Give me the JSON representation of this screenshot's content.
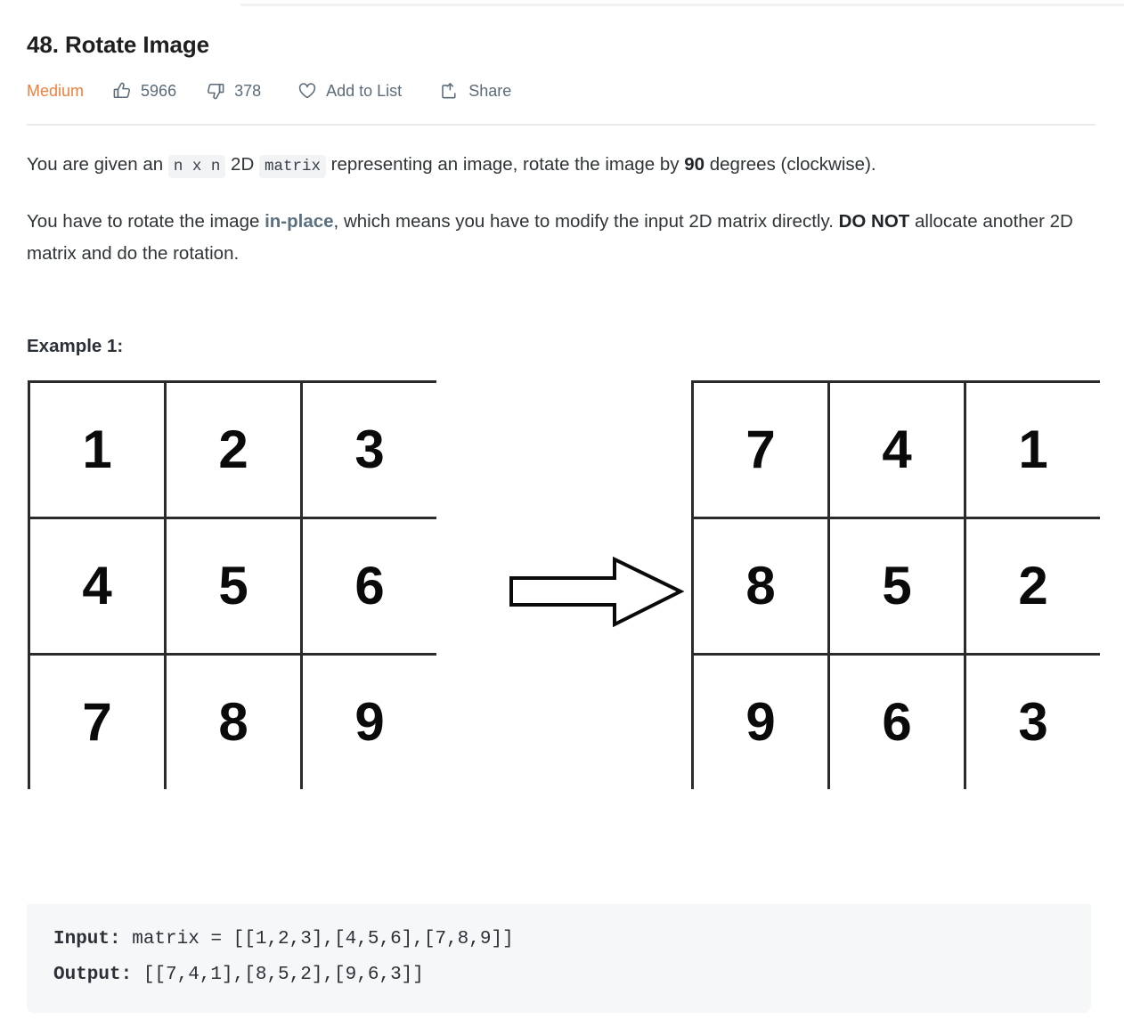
{
  "header": {
    "title": "48. Rotate Image",
    "difficulty": "Medium",
    "actions": [
      {
        "icon": "thumbs-up-icon",
        "label": "5966",
        "name": "likes-button"
      },
      {
        "icon": "thumbs-down-icon",
        "label": "378",
        "name": "dislikes-button"
      },
      {
        "icon": "heart-icon",
        "label": "Add to List",
        "name": "add-to-list-button"
      },
      {
        "icon": "share-icon",
        "label": "Share",
        "name": "share-button"
      }
    ]
  },
  "description": {
    "p1_part1": "You are given an ",
    "p1_code1": "n x n",
    "p1_part2": " 2D ",
    "p1_code2": "matrix",
    "p1_part3": " representing an image, rotate the image by ",
    "p1_bold": "90",
    "p1_part4": " degrees (clockwise).",
    "p2_part1": "You have to rotate the image ",
    "p2_link": "in-place",
    "p2_part2": ", which means you have to modify the input 2D matrix directly. ",
    "p2_bold": "DO NOT",
    "p2_part3": " allocate another 2D matrix and do the rotation."
  },
  "example": {
    "heading": "Example 1:",
    "input_label": "Input:",
    "input_value": " matrix = [[1,2,3],[4,5,6],[7,8,9]]",
    "output_label": "Output:",
    "output_value": " [[7,4,1],[8,5,2],[9,6,3]]",
    "arrow_icon": "right-arrow-icon"
  },
  "chart_data": {
    "type": "table",
    "title": "Example 1: 3x3 matrix rotated 90 degrees clockwise",
    "matrices": [
      {
        "name": "input-matrix",
        "rows": [
          [
            "1",
            "2",
            "3"
          ],
          [
            "4",
            "5",
            "6"
          ],
          [
            "7",
            "8",
            "9"
          ]
        ]
      },
      {
        "name": "output-matrix",
        "rows": [
          [
            "7",
            "4",
            "1"
          ],
          [
            "8",
            "5",
            "2"
          ],
          [
            "9",
            "6",
            "3"
          ]
        ]
      }
    ]
  },
  "colors": {
    "difficulty_medium": "#ef7f3c",
    "action_gray": "#5b6b79",
    "link_inplace": "#5c7080",
    "code_block_bg": "#f6f7f9",
    "grid_line": "#2b2b2b"
  }
}
